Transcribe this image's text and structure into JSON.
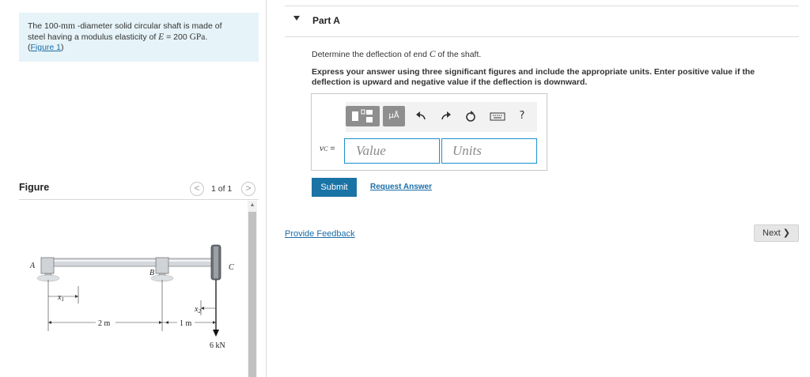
{
  "problem": {
    "text_a": "The 100-",
    "unit_mm": "mm",
    "text_b": " -diameter solid circular shaft is made of",
    "text_c": "steel having a modulus elasticity of ",
    "var_E": "E",
    "text_d": " = 200 ",
    "unit_gpa": "GPa",
    "text_e": ".",
    "figure_link": "Figure 1"
  },
  "figure": {
    "title": "Figure",
    "page_indicator": "1 of 1",
    "prev_symbol": "<",
    "next_symbol": ">",
    "labels": {
      "A": "A",
      "B": "B",
      "C": "C",
      "x1": "x",
      "x1_sub": "1",
      "x2": "x",
      "x2_sub": "2",
      "dim1": "2 m",
      "dim2": "1 m",
      "load": "6 kN"
    }
  },
  "part": {
    "title": "Part A",
    "question_a": "Determine the deflection of end ",
    "question_var": "C",
    "question_b": " of the shaft.",
    "instructions": "Express your answer using three significant figures and include the appropriate units. Enter positive value if the deflection is upward and negative value if the deflection is downward.",
    "var_symbol": "v",
    "var_sub": "C",
    "var_eq": " =",
    "value_placeholder": "Value",
    "units_placeholder": "Units",
    "mu_label": "μÅ",
    "help_label": "?",
    "submit_label": "Submit",
    "request_label": "Request Answer"
  },
  "footer": {
    "feedback_label": "Provide Feedback",
    "next_label": "Next",
    "next_icon": "❯"
  },
  "colors": {
    "accent": "#1a73a5",
    "link": "#1b6ea8",
    "problem_bg": "#e6f3f8",
    "input_border": "#1b8fd1"
  },
  "icons": [
    "template-icon",
    "undo-icon",
    "redo-icon",
    "reset-icon",
    "keyboard-icon",
    "help-icon",
    "chevron-left-icon",
    "chevron-right-icon",
    "collapse-triangle-icon"
  ]
}
